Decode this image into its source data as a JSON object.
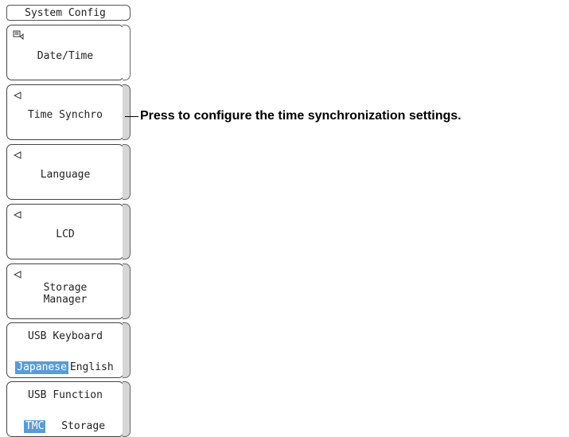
{
  "menu": {
    "title": "System Config",
    "keys": [
      {
        "label": "Date/Time",
        "icon": "menu-page-icon"
      },
      {
        "label": "Time Synchro",
        "icon": "left-triangle-icon"
      },
      {
        "label": "Language",
        "icon": "left-triangle-icon"
      },
      {
        "label": "LCD",
        "icon": "left-triangle-icon"
      },
      {
        "label_line1": "Storage",
        "label_line2": "Manager",
        "icon": "left-triangle-icon"
      },
      {
        "label": "USB Keyboard",
        "options": [
          "Japanese",
          "English"
        ],
        "selected": "Japanese"
      },
      {
        "label": "USB Function",
        "options": [
          "TMC",
          "Storage"
        ],
        "selected": "TMC"
      }
    ]
  },
  "callout": {
    "text": "Press to configure the time synchronization settings."
  },
  "colors": {
    "selected_option": "#5b9bd5",
    "border": "#444444"
  }
}
